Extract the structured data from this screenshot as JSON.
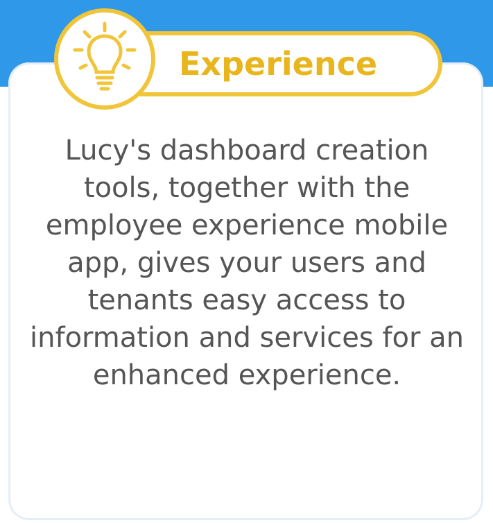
{
  "header": {
    "title": "Experience",
    "icon": "lightbulb-icon"
  },
  "description": "Lucy's dashboard creation tools, together with the employee experience mobile app, gives your users and tenants easy access to information and services for an enhanced experience.",
  "colors": {
    "accent": "#f0c53a",
    "heading_text": "#e9b51d",
    "background_blue": "#2f98e8",
    "body_text": "#555555"
  }
}
